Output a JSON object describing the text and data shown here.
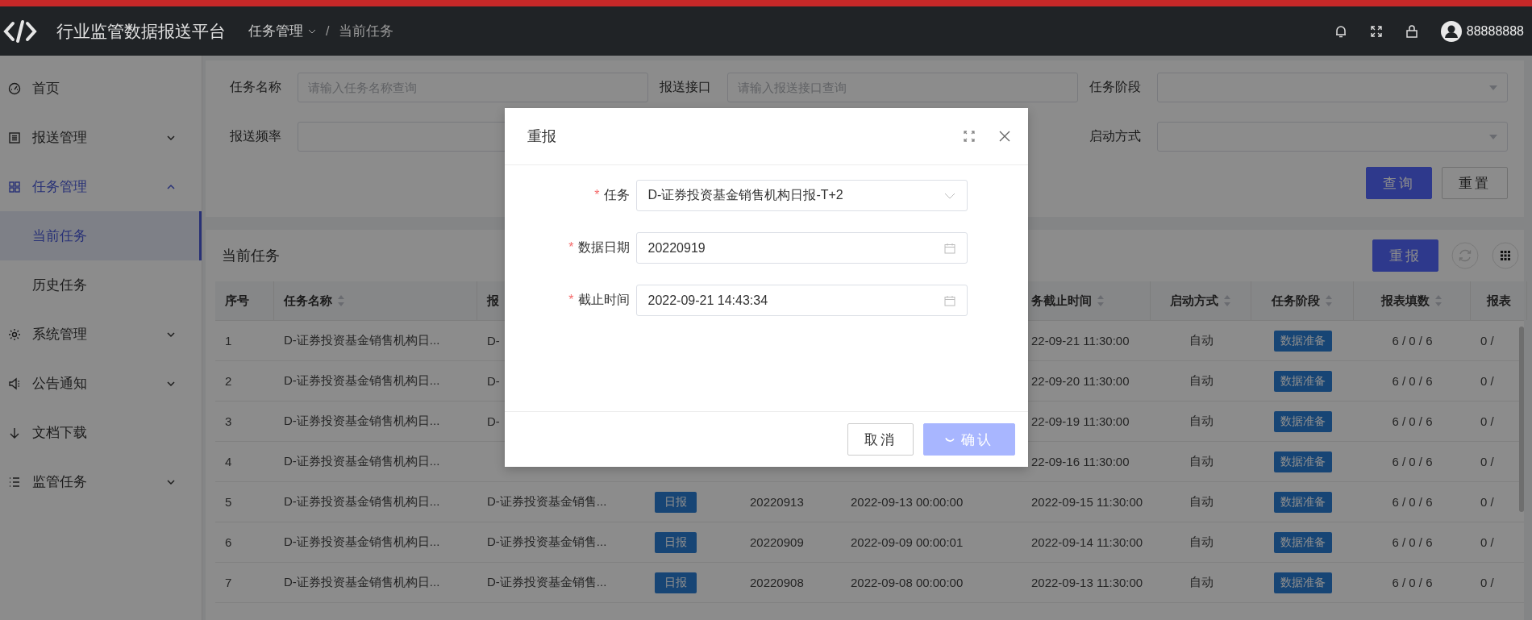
{
  "header": {
    "title": "行业监管数据报送平台",
    "separator": "/",
    "breadcrumb": [
      {
        "label": "任务管理",
        "dropdown": true
      },
      {
        "label": "当前任务",
        "dropdown": false
      }
    ],
    "username": "88888888"
  },
  "sidebar": {
    "items": [
      {
        "label": "首页",
        "selected": false
      },
      {
        "label": "报送管理",
        "selected": false,
        "expanded": false
      },
      {
        "label": "任务管理",
        "selected": true,
        "expanded": true,
        "children": [
          {
            "label": "当前任务",
            "selected": true
          },
          {
            "label": "历史任务",
            "selected": false
          }
        ]
      },
      {
        "label": "系统管理",
        "selected": false,
        "expanded": false
      },
      {
        "label": "公告通知",
        "selected": false,
        "expanded": false
      },
      {
        "label": "文档下载",
        "selected": false
      },
      {
        "label": "监管任务",
        "selected": false,
        "expanded": false
      }
    ]
  },
  "filters": {
    "fields": [
      {
        "label": "任务名称",
        "kind": "input",
        "placeholder": "请输入任务名称查询"
      },
      {
        "label": "报送接口",
        "kind": "input",
        "placeholder": "请输入报送接口查询"
      },
      {
        "label": "任务阶段",
        "kind": "select"
      },
      {
        "label": "报送频率",
        "kind": "input"
      },
      {
        "kind": "hidden"
      },
      {
        "label": "启动方式",
        "kind": "select"
      }
    ],
    "buttons": [
      {
        "label": "查询",
        "primary": true
      },
      {
        "label": "重置",
        "primary": false
      }
    ]
  },
  "table": {
    "title": "当前任务",
    "action": "重报",
    "columns": [
      {
        "label": "序号",
        "sortable": false
      },
      {
        "label": "任务名称",
        "sortable": true
      },
      {
        "label": "报",
        "sortable": false
      },
      {},
      {},
      {},
      {
        "label": "务截止时间",
        "sortable": true
      },
      {
        "label": "启动方式",
        "sortable": true
      },
      {
        "label": "任务阶段",
        "sortable": true
      },
      {
        "label": "报表填数",
        "sortable": true
      },
      {
        "label": "报表",
        "sortable": false
      }
    ],
    "rows": [
      {
        "cells": [
          "1",
          "D-证券投资基金销售机构日...",
          "D-",
          null,
          null,
          null,
          "22-09-21 11:30:00",
          "自动",
          "数据准备",
          "6 / 0 / 6",
          "0 /"
        ]
      },
      {
        "cells": [
          "2",
          "D-证券投资基金销售机构日...",
          "D-",
          null,
          null,
          null,
          "22-09-20 11:30:00",
          "自动",
          "数据准备",
          "6 / 0 / 6",
          "0 /"
        ]
      },
      {
        "cells": [
          "3",
          "D-证券投资基金销售机构日...",
          "D-",
          null,
          null,
          null,
          "22-09-19 11:30:00",
          "自动",
          "数据准备",
          "6 / 0 / 6",
          "0 /"
        ]
      },
      {
        "cells": [
          "4",
          "D-证券投资基金销售机构日...",
          null,
          null,
          null,
          null,
          "22-09-16 11:30:00",
          "自动",
          "数据准备",
          "6 / 0 / 6",
          "0 /"
        ]
      },
      {
        "cells": [
          "5",
          "D-证券投资基金销售机构日...",
          "D-证券投资基金销售...",
          "日报",
          "20220913",
          "2022-09-13 00:00:00",
          "2022-09-15 11:30:00",
          "自动",
          "数据准备",
          "6 / 0 / 6",
          "0 /"
        ]
      },
      {
        "cells": [
          "6",
          "D-证券投资基金销售机构日...",
          "D-证券投资基金销售...",
          "日报",
          "20220909",
          "2022-09-09 00:00:01",
          "2022-09-14 11:30:00",
          "自动",
          "数据准备",
          "6 / 0 / 6",
          "0 /"
        ]
      },
      {
        "cells": [
          "7",
          "D-证券投资基金销售机构日...",
          "D-证券投资基金销售...",
          "日报",
          "20220908",
          "2022-09-08 00:00:00",
          "2022-09-13 11:30:00",
          "自动",
          "数据准备",
          "6 / 0 / 6",
          "0 /"
        ]
      }
    ]
  },
  "dialog": {
    "title": "重报",
    "fields": [
      {
        "label": "任务",
        "required": "*",
        "kind": "select",
        "value": "D-证券投资基金销售机构日报-T+2"
      },
      {
        "label": "数据日期",
        "required": "*",
        "kind": "date",
        "value": "20220919"
      },
      {
        "label": "截止时间",
        "required": "*",
        "kind": "date",
        "value": "2022-09-21 14:43:34"
      }
    ],
    "cancel": "取消",
    "confirm": {
      "label": "确认",
      "loading": true
    }
  }
}
